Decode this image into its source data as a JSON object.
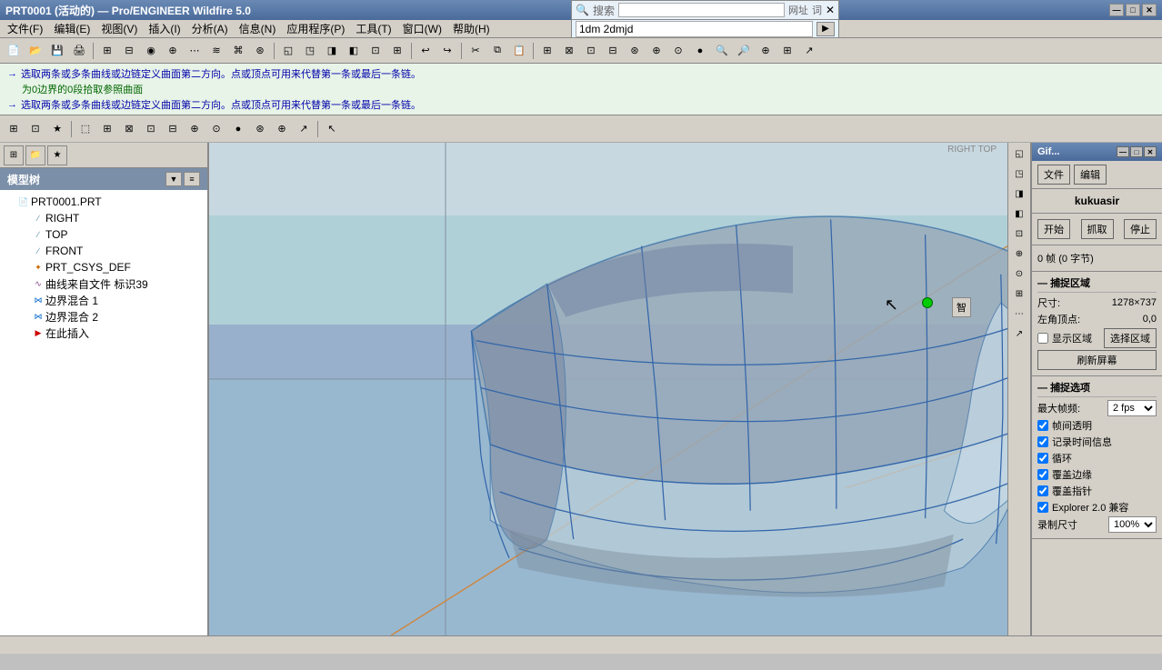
{
  "titleBar": {
    "title": "PRT0001 (活动的) — Pro/ENGINEER Wildfire 5.0",
    "minBtn": "—",
    "maxBtn": "□",
    "closeBtn": "✕"
  },
  "menuBar": {
    "items": [
      {
        "label": "文件(F)",
        "id": "file"
      },
      {
        "label": "编辑(E)",
        "id": "edit"
      },
      {
        "label": "视图(V)",
        "id": "view"
      },
      {
        "label": "插入(I)",
        "id": "insert"
      },
      {
        "label": "分析(A)",
        "id": "analysis"
      },
      {
        "label": "信息(N)",
        "id": "info"
      },
      {
        "label": "应用程序(P)",
        "id": "apps"
      },
      {
        "label": "工具(T)",
        "id": "tools"
      },
      {
        "label": "窗口(W)",
        "id": "window"
      },
      {
        "label": "帮助(H)",
        "id": "help"
      }
    ]
  },
  "hints": [
    {
      "arrow": "→",
      "text": "选取两条或多条曲线或边链定义曲面第二方向。点或顶点可用来代替第一条或最后一条链。"
    },
    {
      "sub": "为0边界的0段拾取参照曲面"
    },
    {
      "arrow": "→",
      "text": "选取两条或多条曲线或边链定义曲面第二方向。点或顶点可用来代替第一条或最后一条链。"
    }
  ],
  "modelTree": {
    "title": "模型树",
    "items": [
      {
        "level": 0,
        "icon": "📄",
        "label": "PRT0001.PRT",
        "type": "root"
      },
      {
        "level": 1,
        "icon": "/",
        "label": "RIGHT",
        "type": "plane"
      },
      {
        "level": 1,
        "icon": "/",
        "label": "TOP",
        "type": "plane"
      },
      {
        "level": 1,
        "icon": "/",
        "label": "FRONT",
        "type": "plane"
      },
      {
        "level": 1,
        "icon": "✦",
        "label": "PRT_CSYS_DEF",
        "type": "csys"
      },
      {
        "level": 1,
        "icon": "~",
        "label": "曲线来自文件  标识39",
        "type": "curve"
      },
      {
        "level": 1,
        "icon": "⋈",
        "label": "边界混合 1",
        "type": "blend"
      },
      {
        "level": 1,
        "icon": "⋈",
        "label": "边界混合 2",
        "type": "blend"
      },
      {
        "level": 1,
        "icon": "▶",
        "label": "在此插入",
        "type": "insert"
      }
    ]
  },
  "viewport": {
    "bgColors": [
      "#c0d0dc",
      "#a8c0cc",
      "#9ab0c4"
    ]
  },
  "rightPanel": {
    "title": "Gif...",
    "fileLabel": "文件",
    "editLabel": "编辑",
    "username": "kukuasir",
    "startBtn": "开始",
    "captureBtn": "抓取",
    "stopBtn": "停止",
    "frameInfo": "0 帧  (0 字节)",
    "captureRegionTitle": "捕捉区域",
    "sizeLabel": "尺寸:",
    "sizeValue": "1278×737",
    "topLeftLabel": "左角顶点:",
    "topLeftValue": "0,0",
    "showRegionLabel": "显示区域",
    "selectRegionBtn": "选择区域",
    "refreshBtn": "刷新屏幕",
    "captureOptionsTitle": "捕捉选项",
    "maxFpsLabel": "最大帧频:",
    "maxFpsValue": "2 fps",
    "transparentLabel": "帧间透明",
    "recordTimeLabel": "记录时间信息",
    "loopLabel": "循环",
    "overlayCurveLabel": "覆盖边缘",
    "overlayPointerLabel": "覆盖指针",
    "explorerLabel": "Explorer 2.0 兼容",
    "recordSizeLabel": "录制尺寸",
    "recordSizeValue": "100%"
  },
  "statusBar": {
    "text": ""
  },
  "searchBar": {
    "placeholder": "搜索",
    "addressLabel": "网址",
    "wordLabel": "词",
    "searchValue": "1dm 2dmjd"
  }
}
